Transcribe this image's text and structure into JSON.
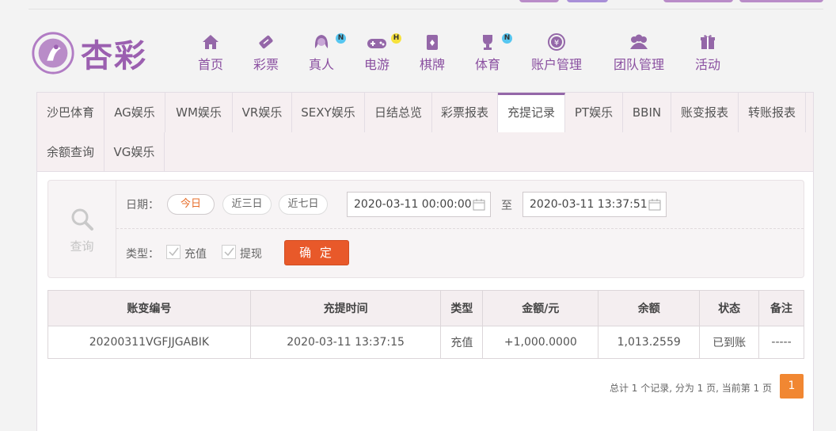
{
  "brand": {
    "logo_text": "杏彩",
    "color": "#9b5fb0"
  },
  "nav": [
    {
      "label": "首页",
      "icon": "home-icon"
    },
    {
      "label": "彩票",
      "icon": "ticket-icon"
    },
    {
      "label": "真人",
      "icon": "dealer-icon",
      "badge": "N"
    },
    {
      "label": "电游",
      "icon": "gamepad-icon",
      "badge": "H"
    },
    {
      "label": "棋牌",
      "icon": "cards-icon"
    },
    {
      "label": "体育",
      "icon": "trophy-icon",
      "badge": "N"
    },
    {
      "label": "账户管理",
      "icon": "yen-icon"
    },
    {
      "label": "团队管理",
      "icon": "team-icon"
    },
    {
      "label": "活动",
      "icon": "gift-icon"
    }
  ],
  "tabs": [
    "沙巴体育",
    "AG娱乐",
    "WM娱乐",
    "VR娱乐",
    "SEXY娱乐",
    "日结总览",
    "彩票报表",
    "充提记录",
    "PT娱乐",
    "BBIN",
    "账变报表",
    "转账报表",
    "余额查询",
    "VG娱乐"
  ],
  "active_tab": "充提记录",
  "filter": {
    "search_label": "查询",
    "date_label": "日期：",
    "quick_ranges": [
      "今日",
      "近三日",
      "近七日"
    ],
    "start": "2020-03-11 00:00:00",
    "to_label": "至",
    "end": "2020-03-11 13:37:51",
    "type_label": "类型：",
    "types": [
      "充值",
      "提现"
    ],
    "confirm": "确 定"
  },
  "table": {
    "headers": [
      "账变编号",
      "充提时间",
      "类型",
      "金额/元",
      "余额",
      "状态",
      "备注"
    ],
    "rows": [
      [
        "20200311VGFJJGABIK",
        "2020-03-11 13:37:15",
        "充值",
        "+1,000.0000",
        "1,013.2559",
        "已到账",
        "-----"
      ]
    ]
  },
  "pager": {
    "summary": "总计 1 个记录, 分为 1 页, 当前第 1 页",
    "current": "1"
  }
}
